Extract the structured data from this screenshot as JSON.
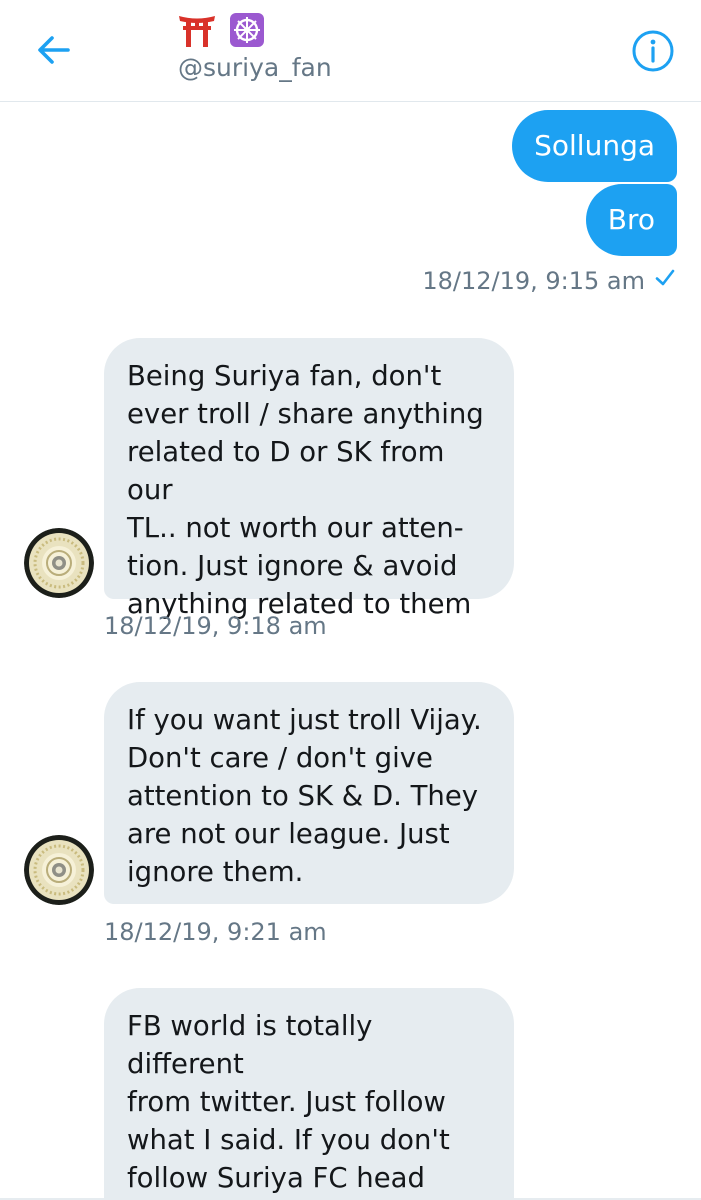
{
  "header": {
    "emojis": [
      "⛩",
      "☸"
    ],
    "handle": "@suriya_fan"
  },
  "outgoing": {
    "messages": [
      "Sollunga",
      "Bro"
    ],
    "timestamp": "18/12/19, 9:15 am"
  },
  "incoming": [
    {
      "text": "Being Suriya fan, don't\never troll / share anything\nrelated to D or SK from our\nTL.. not worth our atten-\ntion. Just ignore & avoid\nanything related to them",
      "timestamp": "18/12/19, 9:18 am"
    },
    {
      "text": "If you want just troll Vijay.\nDon't care / don't give\nattention to SK & D. They\nare not our league. Just\nignore them.",
      "timestamp": "18/12/19, 9:21 am"
    },
    {
      "text": "FB world is totally different\nfrom twitter. Just follow\nwhat I said. If you don't\nfollow Suriya FC head\nitself will report & suspend"
    }
  ],
  "colors": {
    "accent": "#1da1f2",
    "incoming_bubble": "#e6ecf0",
    "meta_text": "#657786"
  },
  "icons": [
    "back-arrow-icon",
    "info-icon",
    "read-check-icon",
    "avatar"
  ]
}
